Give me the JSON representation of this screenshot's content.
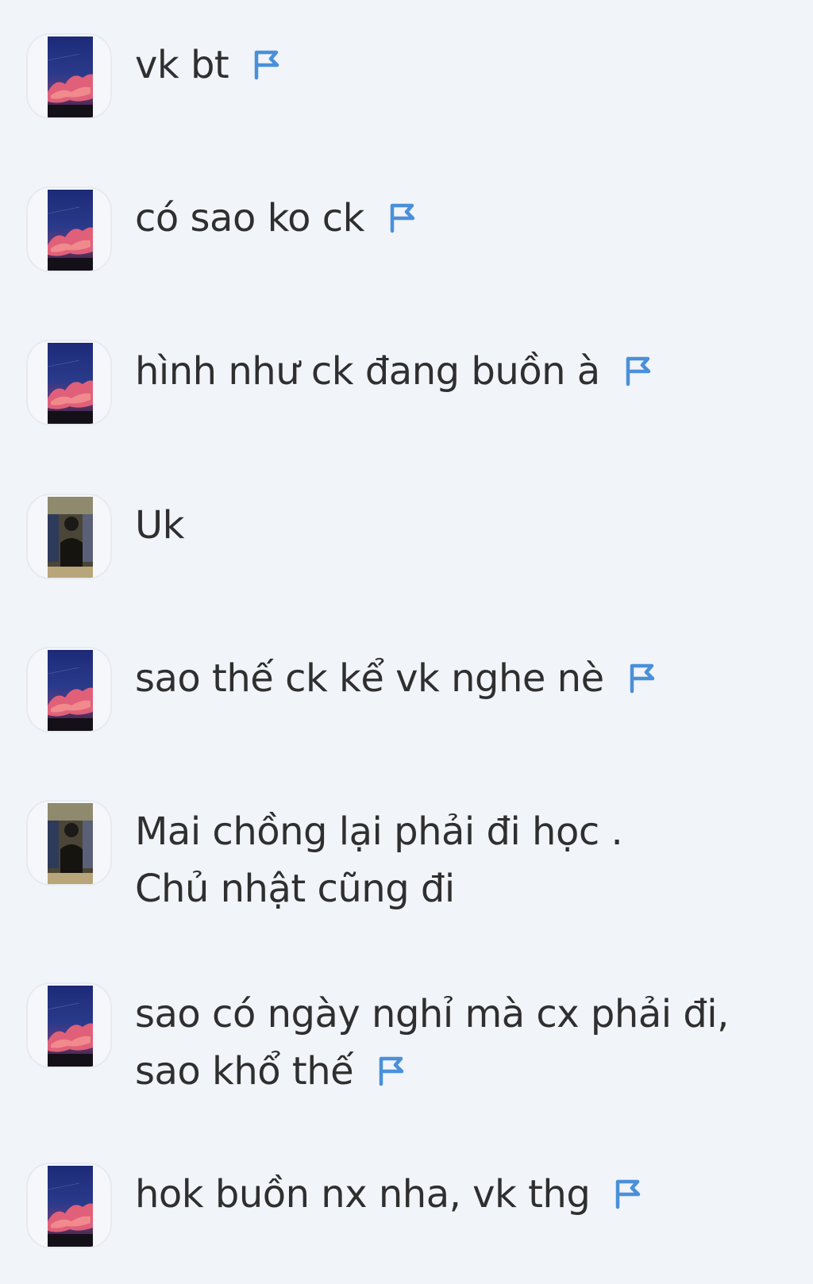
{
  "colors": {
    "background": "#f1f4f9",
    "text": "#2f2f2f",
    "flag": "#4a90d9"
  },
  "messages": [
    {
      "text": "vk bt",
      "avatar": "sunset-avatar",
      "flag": true
    },
    {
      "text": "có sao ko ck",
      "avatar": "sunset-avatar",
      "flag": true
    },
    {
      "text": "hình như ck đang buồn à",
      "avatar": "sunset-avatar",
      "flag": true
    },
    {
      "text": "Uk",
      "avatar": "person-avatar",
      "flag": false
    },
    {
      "text": "sao thế ck kể vk nghe nè",
      "avatar": "sunset-avatar",
      "flag": true
    },
    {
      "text": "Mai chồng lại phải đi học . Chủ nhật cũng đi",
      "avatar": "person-avatar",
      "flag": false
    },
    {
      "text": "sao có ngày nghỉ mà cx phải đi, sao khổ thế",
      "avatar": "sunset-avatar",
      "flag": true
    },
    {
      "text": "hok buồn nx nha, vk thg",
      "avatar": "sunset-avatar",
      "flag": true
    }
  ]
}
